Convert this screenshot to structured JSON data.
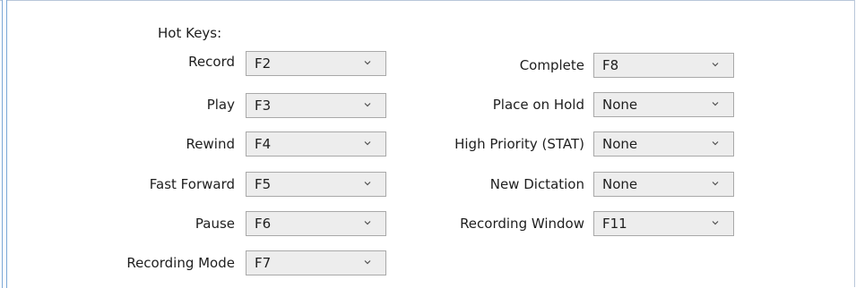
{
  "hotkeys": {
    "title": "Hot Keys:",
    "left": [
      {
        "label": "Record",
        "value": "F2"
      },
      {
        "label": "Play",
        "value": "F3"
      },
      {
        "label": "Rewind",
        "value": "F4"
      },
      {
        "label": "Fast Forward",
        "value": "F5"
      },
      {
        "label": "Pause",
        "value": "F6"
      },
      {
        "label": "Recording Mode",
        "value": "F7"
      }
    ],
    "right": [
      {
        "label": "Complete",
        "value": "F8"
      },
      {
        "label": "Place on Hold",
        "value": "None"
      },
      {
        "label": "High Priority (STAT)",
        "value": "None"
      },
      {
        "label": "New Dictation",
        "value": "None"
      },
      {
        "label": "Recording Window",
        "value": "F11"
      }
    ]
  },
  "icons": {
    "dropdown": "chevron-down-icon"
  }
}
